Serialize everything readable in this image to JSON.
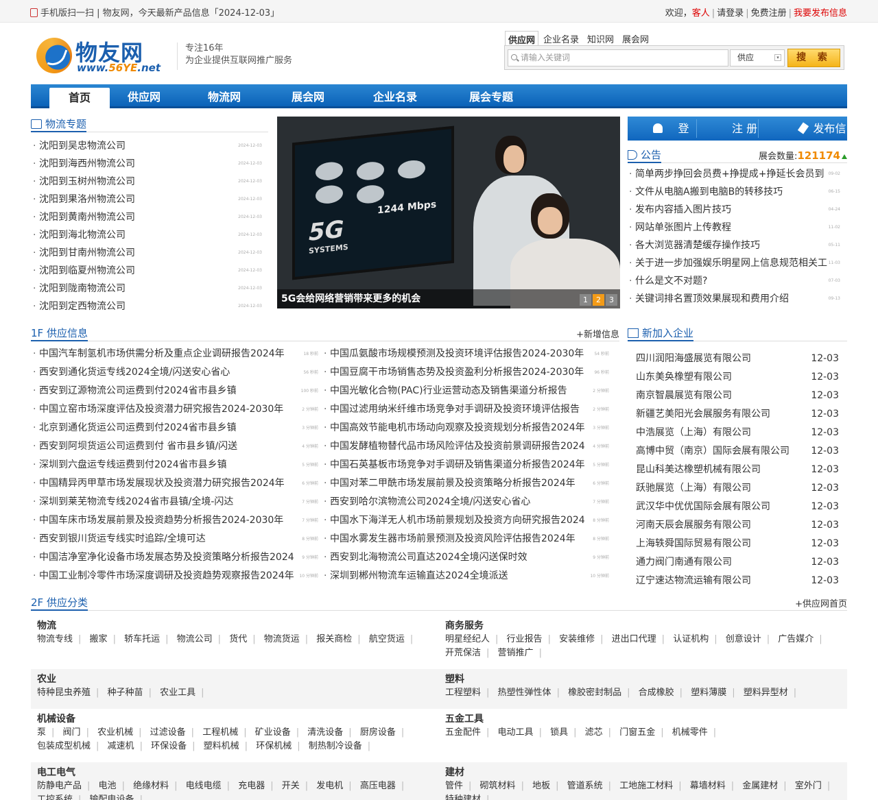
{
  "topbar": {
    "left_text": "手机版扫一扫 | 物友网，今天最新产品信息「2024-12-03」",
    "welcome": "欢迎，",
    "guest": "客人",
    "login": "请登录",
    "register": "免费注册",
    "publish": "我要发布信息"
  },
  "logo": {
    "cn": "物友网",
    "en_prefix": "www.",
    "en_mid": "56YE",
    "en_suffix": ".net"
  },
  "slogan": {
    "line1": "专注16年",
    "line2": "为企业提供互联网推广服务"
  },
  "search": {
    "tabs": [
      "供应网",
      "企业名录",
      "知识网",
      "展会网"
    ],
    "placeholder": "请输入关键词",
    "select": "供应",
    "button": "搜 索"
  },
  "nav": [
    "首页",
    "供应网",
    "物流网",
    "展会网",
    "企业名录",
    "展会专题"
  ],
  "logistics": {
    "title": "物流专题",
    "items": [
      {
        "t": "沈阳到吴忠物流公司",
        "d": "2024-12-03"
      },
      {
        "t": "沈阳到海西州物流公司",
        "d": "2024-12-03"
      },
      {
        "t": "沈阳到玉树州物流公司",
        "d": "2024-12-03"
      },
      {
        "t": "沈阳到果洛州物流公司",
        "d": "2024-12-03"
      },
      {
        "t": "沈阳到黄南州物流公司",
        "d": "2024-12-03"
      },
      {
        "t": "沈阳到海北物流公司",
        "d": "2024-12-03"
      },
      {
        "t": "沈阳到甘南州物流公司",
        "d": "2024-12-03"
      },
      {
        "t": "沈阳到临夏州物流公司",
        "d": "2024-12-03"
      },
      {
        "t": "沈阳到陇南物流公司",
        "d": "2024-12-03"
      },
      {
        "t": "沈阳到定西物流公司",
        "d": "2024-12-03"
      }
    ]
  },
  "banner": {
    "caption": "5G会给网络营销带来更多的机会",
    "screen_big": "5G",
    "screen_sub": "SYSTEMS",
    "screen_rate": "1244 Mbps",
    "dots": [
      "1",
      "2",
      "3"
    ]
  },
  "actions": {
    "login": "登 录",
    "register": "注 册",
    "publish": "发布信息"
  },
  "notice": {
    "title": "公告",
    "stat_label": "展会数量:",
    "stat_value": "121174",
    "items": [
      {
        "t": "简单两步挣回会员费+挣提成+挣延长会员到",
        "d": "09-02"
      },
      {
        "t": "文件从电脑A搬到电脑B的转移技巧",
        "d": "06-15"
      },
      {
        "t": "发布内容插入图片技巧",
        "d": "04-24"
      },
      {
        "t": "网站单张图片上传教程",
        "d": "11-02"
      },
      {
        "t": "各大浏览器清楚缓存操作技巧",
        "d": "05-11"
      },
      {
        "t": "关于进一步加强娱乐明星网上信息规范相关工",
        "d": "11-03"
      },
      {
        "t": "什么是文不对题?",
        "d": "07-03"
      },
      {
        "t": "关键词排名置顶效果展现和费用介绍",
        "d": "09-13"
      }
    ]
  },
  "supply": {
    "title": "1F 供应信息",
    "more": "+新增信息",
    "col1": [
      {
        "t": "中国汽车制氢机市场供需分析及重点企业调研报告2024年",
        "d": "18 秒前"
      },
      {
        "t": "西安到通化货运专线2024全境/闪送安心省心",
        "d": "56 秒前"
      },
      {
        "t": "西安到辽源物流公司运费到付2024省市县乡镇",
        "d": "100 秒前"
      },
      {
        "t": "中国立窑市场深度评估及投资潜力研究报告2024-2030年",
        "d": "2 分钟前"
      },
      {
        "t": "北京到通化货运公司运费到付2024省市县乡镇",
        "d": "3 分钟前"
      },
      {
        "t": "西安到阿坝货运公司运费到付 省市县乡镇/闪送",
        "d": "4 分钟前"
      },
      {
        "t": "深圳到六盘运专线运费到付2024省市县乡镇",
        "d": "5 分钟前"
      },
      {
        "t": "中国精异丙甲草市场发展现状及投资潜力研究报告2024年",
        "d": "6 分钟前"
      },
      {
        "t": "深圳到莱芜物流专线2024省市县镇/全境-闪达",
        "d": "7 分钟前"
      },
      {
        "t": "中国车床市场发展前景及投资趋势分析报告2024-2030年",
        "d": "7 分钟前"
      },
      {
        "t": "西安到银川货运专线实时追踪/全境可达",
        "d": "8 分钟前"
      },
      {
        "t": "中国洁净室净化设备市场发展态势及投资策略分析报告2024",
        "d": "9 分钟前"
      },
      {
        "t": "中国工业制冷零件市场深度调研及投资趋势观察报告2024年",
        "d": "10 分钟前"
      }
    ],
    "col2": [
      {
        "t": "中国瓜氨酸市场规模预测及投资环境评估报告2024-2030年",
        "d": "54 秒前"
      },
      {
        "t": "中国豆腐干市场销售态势及投资盈利分析报告2024-2030年",
        "d": "96 秒前"
      },
      {
        "t": "中国光敏化合物(PAC)行业运营动态及销售渠道分析报告",
        "d": "2 分钟前"
      },
      {
        "t": "中国过滤用纳米纤维市场竞争对手调研及投资环境评估报告",
        "d": "2 分钟前"
      },
      {
        "t": "中国高效节能电机市场动向观察及投资规划分析报告2024年",
        "d": "3 分钟前"
      },
      {
        "t": "中国发酵植物替代品市场风险评估及投资前景调研报告2024",
        "d": "4 分钟前"
      },
      {
        "t": "中国石英基板市场竞争对手调研及销售渠道分析报告2024年",
        "d": "5 分钟前"
      },
      {
        "t": "中国对苯二甲酰市场发展前景及投资策略分析报告2024年",
        "d": "6 分钟前"
      },
      {
        "t": "西安到哈尔滨物流公司2024全境/闪送安心省心",
        "d": "7 分钟前"
      },
      {
        "t": "中国水下海洋无人机市场前景规划及投资方向研究报告2024",
        "d": "8 分钟前"
      },
      {
        "t": "中国水雾发生器市场前景预测及投资风险评估报告2024年",
        "d": "8 分钟前"
      },
      {
        "t": "西安到北海物流公司直达2024全境闪送保时效",
        "d": "9 分钟前"
      },
      {
        "t": "深圳到郴州物流车运输直达2024全境派送",
        "d": "10 分钟前"
      }
    ]
  },
  "new_companies": {
    "title": "新加入企业",
    "items": [
      {
        "t": "四川润阳海盛展览有限公司",
        "d": "12-03"
      },
      {
        "t": "山东美奂橡塑有限公司",
        "d": "12-03"
      },
      {
        "t": "南京智晨展览有限公司",
        "d": "12-03"
      },
      {
        "t": "新疆艺美阳光会展服务有限公司",
        "d": "12-03"
      },
      {
        "t": "中浩展览（上海）有限公司",
        "d": "12-03"
      },
      {
        "t": "高博中贸（南京）国际会展有限公司",
        "d": "12-03"
      },
      {
        "t": "昆山科美达橡塑机械有限公司",
        "d": "12-03"
      },
      {
        "t": "跃驰展览（上海）有限公司",
        "d": "12-03"
      },
      {
        "t": "武汉华中优优国际会展有限公司",
        "d": "12-03"
      },
      {
        "t": "河南天辰会展服务有限公司",
        "d": "12-03"
      },
      {
        "t": "上海轶舜国际贸易有限公司",
        "d": "12-03"
      },
      {
        "t": "通力阀门南通有限公司",
        "d": "12-03"
      },
      {
        "t": "辽宁速达物流运输有限公司",
        "d": "12-03"
      }
    ]
  },
  "categories": {
    "title": "2F 供应分类",
    "more": "+供应网首页",
    "rows": [
      [
        {
          "h": "物流",
          "items": [
            "物流专线",
            "搬家",
            "轿车托运",
            "物流公司",
            "货代",
            "物流货运",
            "报关商检",
            "航空货运"
          ]
        },
        {
          "h": "商务服务",
          "items": [
            "明星经纪人",
            "行业报告",
            "安装维修",
            "进出口代理",
            "认证机构",
            "创意设计",
            "广告媒介",
            "开荒保洁",
            "营销推广"
          ]
        }
      ],
      [
        {
          "h": "农业",
          "items": [
            "特种昆虫养殖",
            "种子种苗",
            "农业工具"
          ]
        },
        {
          "h": "塑料",
          "items": [
            "工程塑料",
            "热塑性弹性体",
            "橡胶密封制品",
            "合成橡胶",
            "塑料薄膜",
            "塑料异型材"
          ]
        }
      ],
      [
        {
          "h": "机械设备",
          "items": [
            "泵",
            "阀门",
            "农业机械",
            "过滤设备",
            "工程机械",
            "矿业设备",
            "清洗设备",
            "厨房设备",
            "包装成型机械",
            "减速机",
            "环保设备",
            "塑料机械",
            "环保机械",
            "制热制冷设备"
          ]
        },
        {
          "h": "五金工具",
          "items": [
            "五金配件",
            "电动工具",
            "锁具",
            "滤芯",
            "门窗五金",
            "机械零件"
          ]
        }
      ],
      [
        {
          "h": "电工电气",
          "items": [
            "防静电产品",
            "电池",
            "绝缘材料",
            "电线电缆",
            "充电器",
            "开关",
            "发电机",
            "高压电器",
            "工控系统",
            "输配电设备"
          ]
        },
        {
          "h": "建材",
          "items": [
            "管件",
            "砌筑材料",
            "地板",
            "管道系统",
            "工地施工材料",
            "幕墙材料",
            "金属建材",
            "室外门",
            "特种建材"
          ]
        }
      ]
    ]
  }
}
